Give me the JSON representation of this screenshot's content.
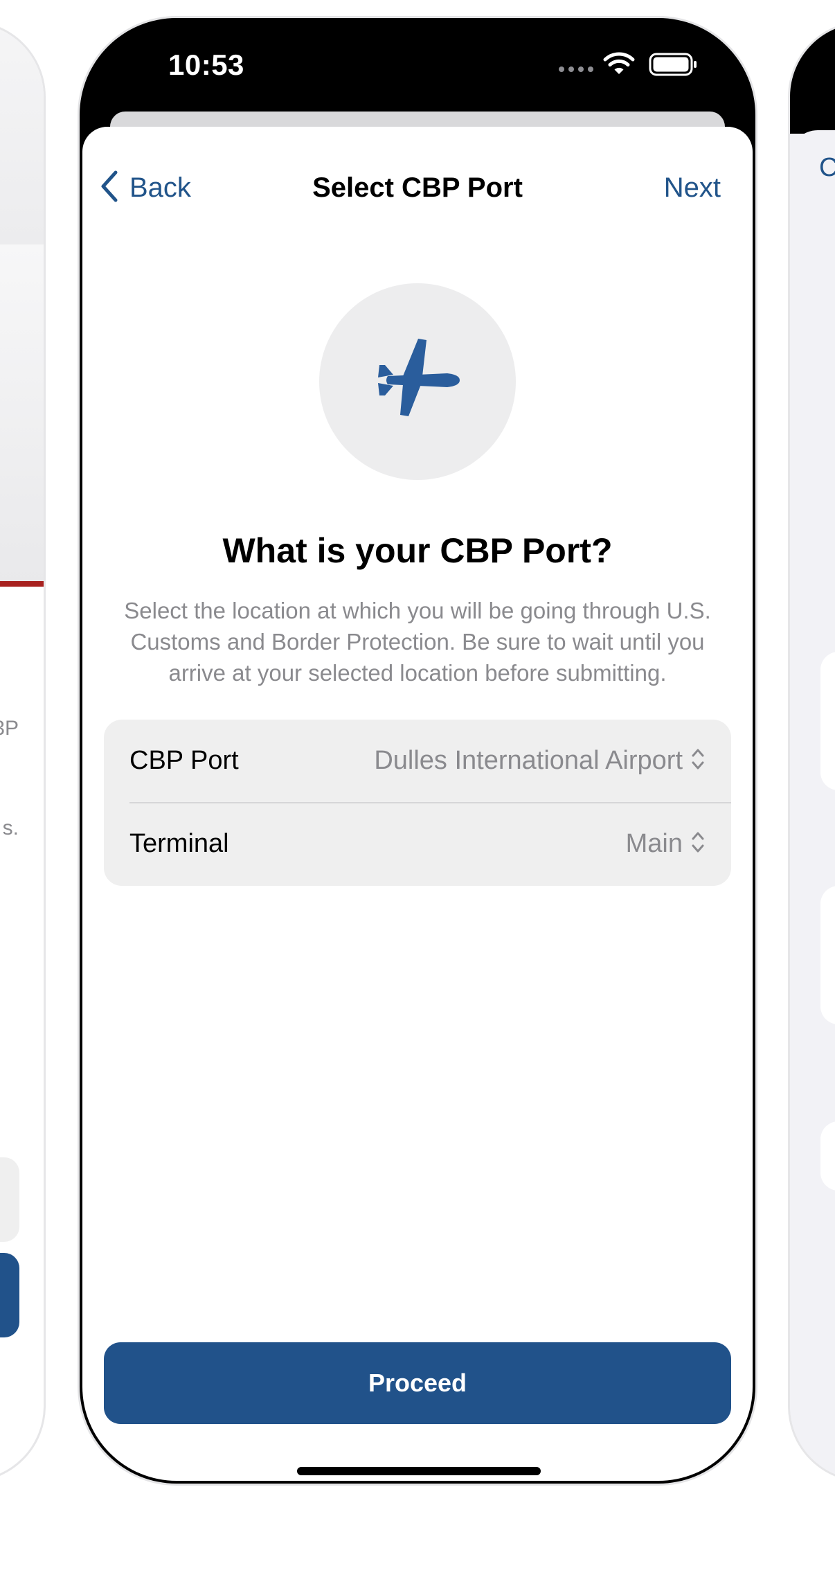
{
  "status_bar": {
    "time": "10:53",
    "icons": [
      "cellular-signal-icon",
      "wifi-icon",
      "battery-icon"
    ]
  },
  "nav": {
    "back_label": "Back",
    "title": "Select CBP Port",
    "next_label": "Next"
  },
  "hero": {
    "icon": "airplane-icon",
    "heading": "What is your CBP Port?",
    "description": "Select the location at which you will be going through U.S. Customs and Border Protection. Be sure to wait until you arrive at your selected location before submitting."
  },
  "form": {
    "port": {
      "label": "CBP Port",
      "value": "Dulles International Airport"
    },
    "terminal": {
      "label": "Terminal",
      "value": "Main"
    }
  },
  "actions": {
    "proceed_label": "Proceed"
  },
  "peek_left": {
    "text_fragments": [
      "3P",
      "s."
    ]
  },
  "peek_right": {
    "letter": "C"
  },
  "colors": {
    "accent": "#21548a",
    "button": "#21528a",
    "secondary_text": "#8a8a8e",
    "grouped_background": "#efefef",
    "red_accent": "#a8211f"
  }
}
